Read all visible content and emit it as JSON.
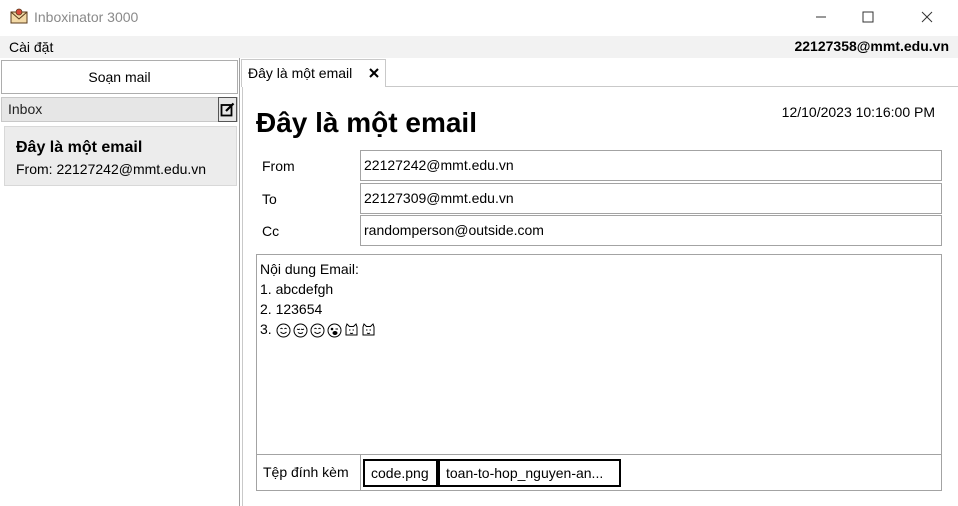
{
  "window": {
    "title": "Inboxinator 3000",
    "icon": "envelope-icon"
  },
  "menu": {
    "settings_label": "Cài đặt",
    "user_email": "22127358@mmt.edu.vn"
  },
  "sidebar": {
    "compose_label": "Soạn mail",
    "inbox_label": "Inbox",
    "edit_icon": "edit-icon",
    "mails": [
      {
        "subject": "Đây là một email",
        "from": "From: 22127242@mmt.edu.vn"
      }
    ]
  },
  "tab": {
    "label": "Đây là một email",
    "close_icon": "close-icon"
  },
  "email": {
    "title": "Đây là một email",
    "date": "12/10/2023 10:16:00 PM",
    "from_label": "From",
    "from_value": "22127242@mmt.edu.vn",
    "to_label": "To",
    "to_value": "22127309@mmt.edu.vn",
    "cc_label": "Cc",
    "cc_value": "randomperson@outside.com",
    "body_lines": [
      "Nội dung Email:",
      "1. abcdefgh",
      "2. 123654",
      "3."
    ],
    "emoji_icons": [
      "smiling-face-icon",
      "relieved-face-icon",
      "smiling-face-icon",
      "winking-tongue-face-icon",
      "cat-face-icon",
      "cat-face-icon"
    ],
    "attach_label": "Tệp đính kèm",
    "attachments": [
      "code.png",
      "toan-to-hop_nguyen-an..."
    ]
  }
}
